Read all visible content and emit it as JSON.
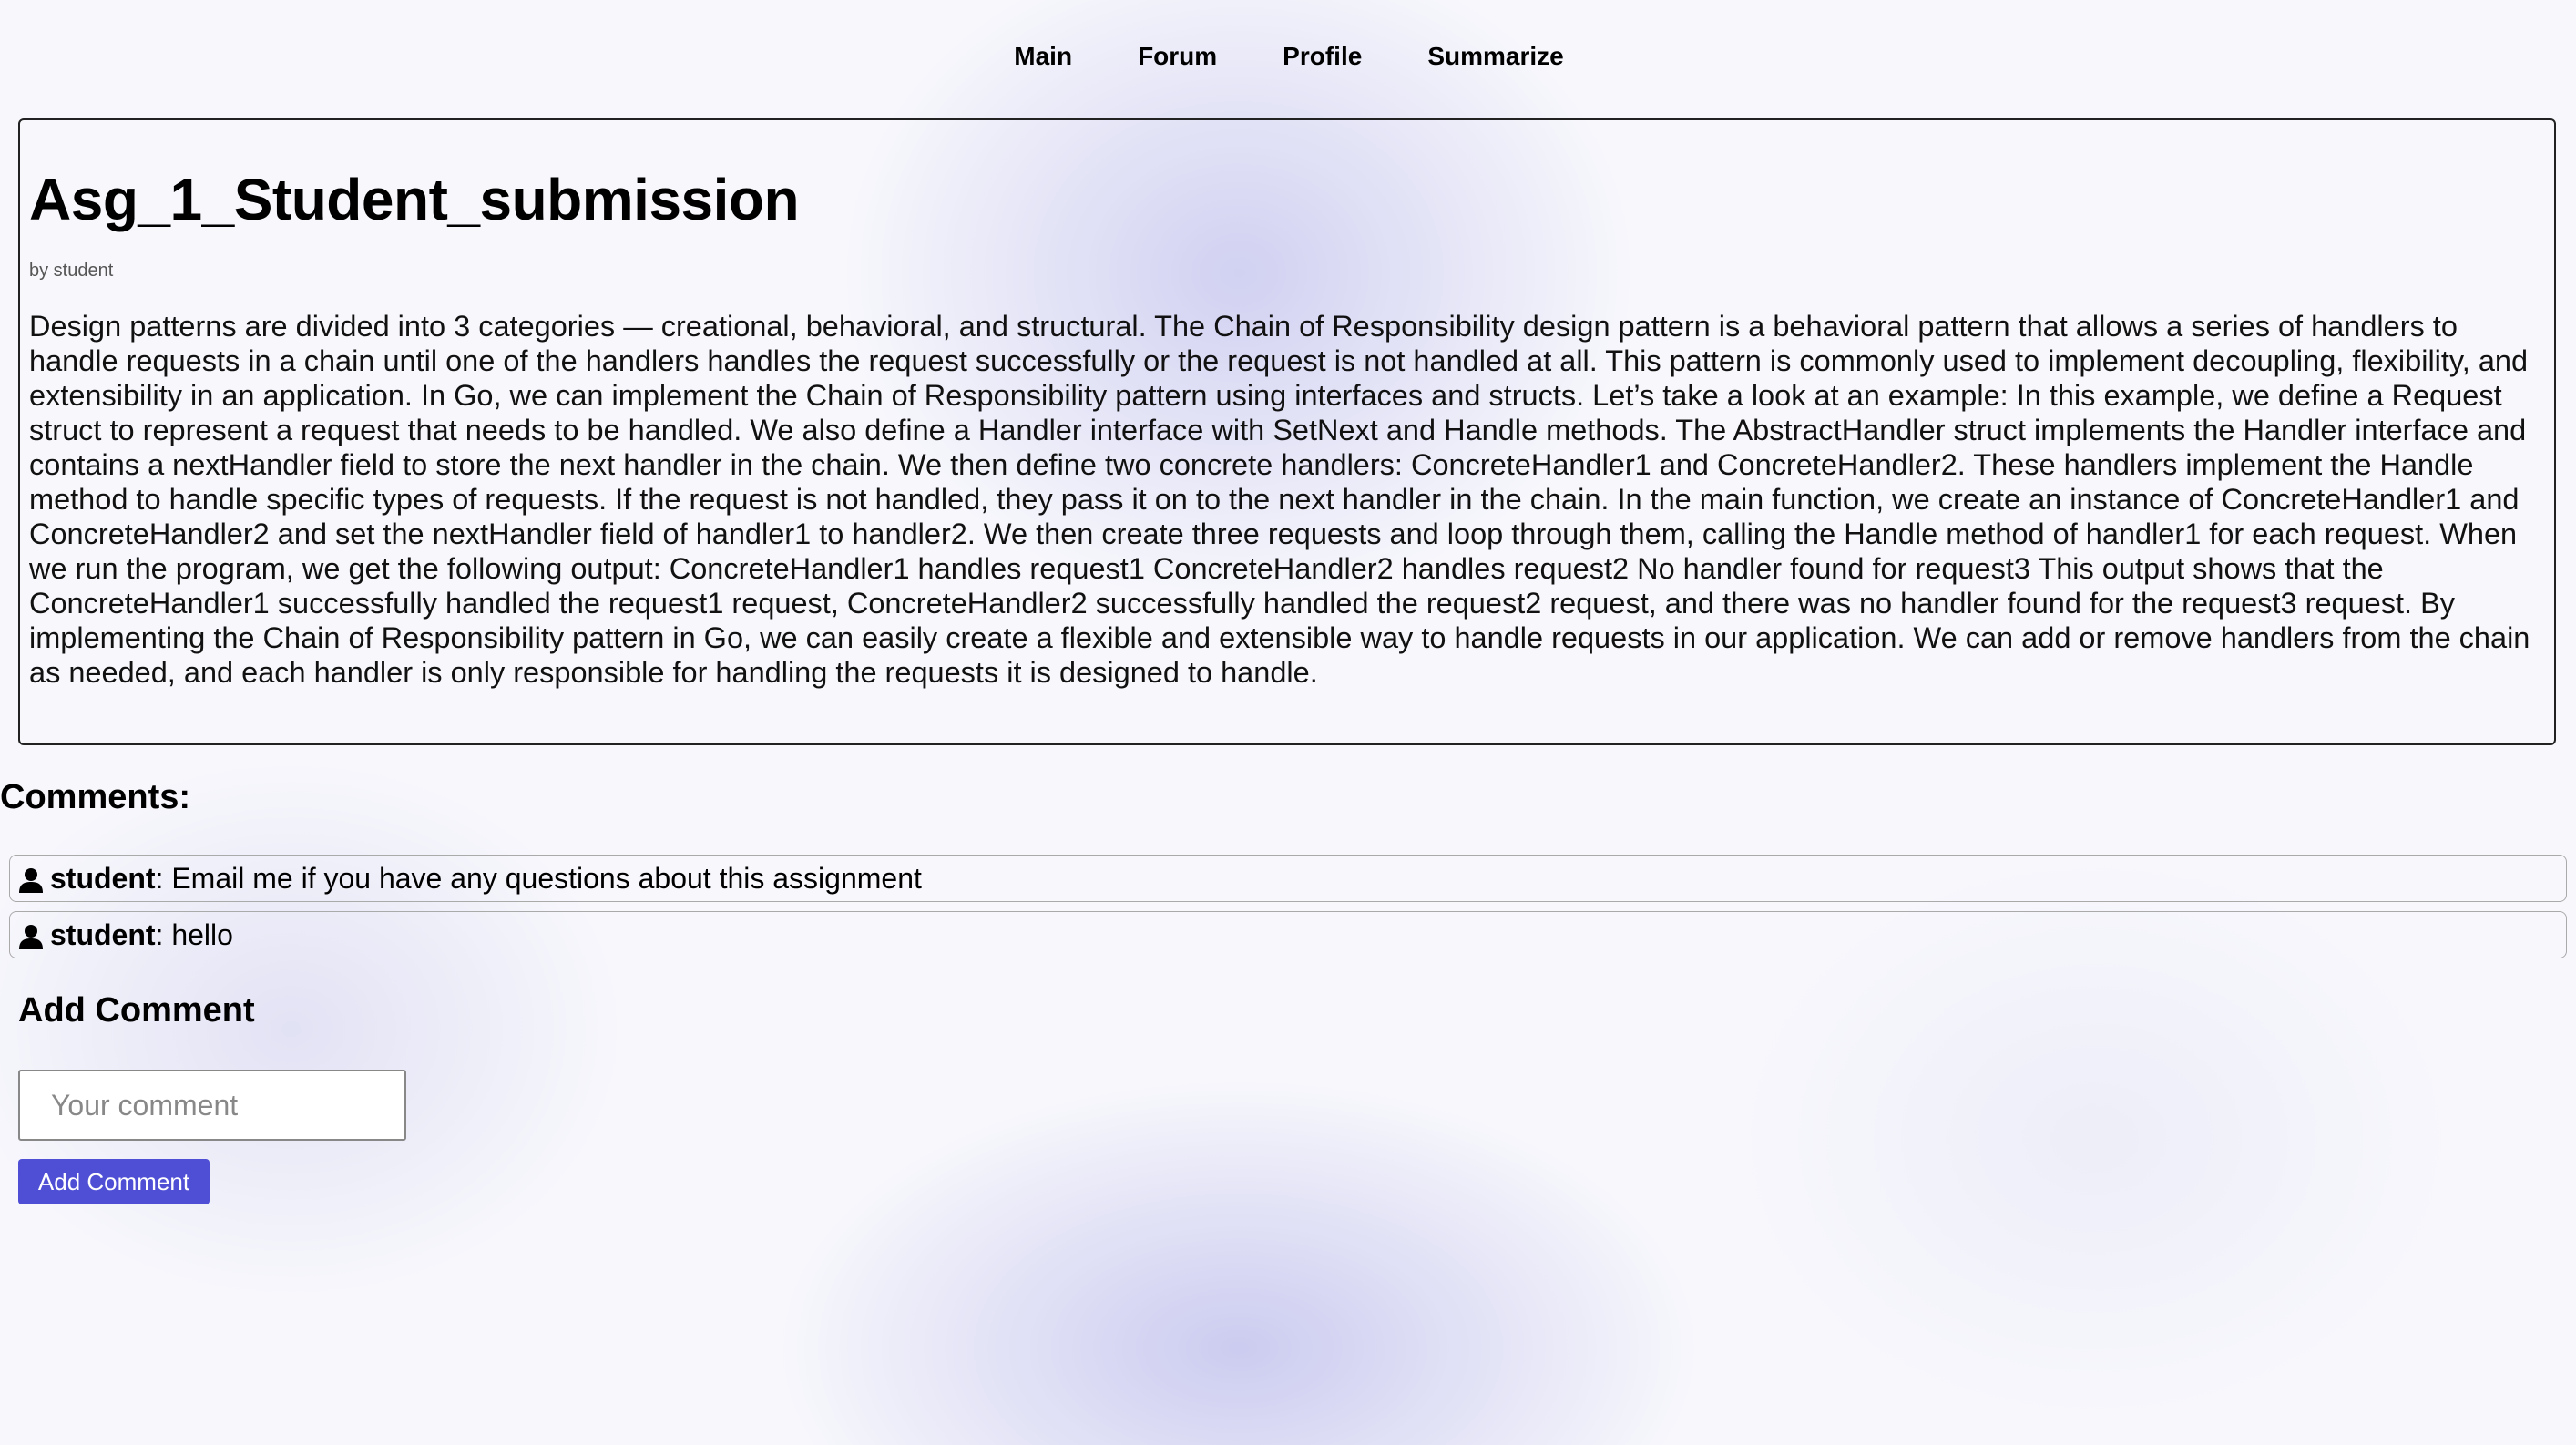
{
  "nav": {
    "items": [
      "Main",
      "Forum",
      "Profile",
      "Summarize"
    ]
  },
  "post": {
    "title": "Asg_1_Student_submission",
    "author_line": "by student",
    "body": "Design patterns are divided into 3 categories — creational, behavioral, and structural. The Chain of Responsibility design pattern is a behavioral pattern that allows a series of handlers to handle requests in a chain until one of the handlers handles the request successfully or the request is not handled at all. This pattern is commonly used to implement decoupling, flexibility, and extensibility in an application. In Go, we can implement the Chain of Responsibility pattern using interfaces and structs. Let’s take a look at an example: In this example, we define a Request struct to represent a request that needs to be handled. We also define a Handler interface with SetNext and Handle methods. The AbstractHandler struct implements the Handler interface and contains a nextHandler field to store the next handler in the chain. We then define two concrete handlers: ConcreteHandler1 and ConcreteHandler2. These handlers implement the Handle method to handle specific types of requests. If the request is not handled, they pass it on to the next handler in the chain. In the main function, we create an instance of ConcreteHandler1 and ConcreteHandler2 and set the nextHandler field of handler1 to handler2. We then create three requests and loop through them, calling the Handle method of handler1 for each request. When we run the program, we get the following output: ConcreteHandler1 handles request1 ConcreteHandler2 handles request2 No handler found for request3 This output shows that the ConcreteHandler1 successfully handled the request1 request, ConcreteHandler2 successfully handled the request2 request, and there was no handler found for the request3 request. By implementing the Chain of Responsibility pattern in Go, we can easily create a flexible and extensible way to handle requests in our application. We can add or remove handlers from the chain as needed, and each handler is only responsible for handling the requests it is designed to handle."
  },
  "comments": {
    "heading": "Comments:",
    "items": [
      {
        "icon": "user-icon",
        "author": "student",
        "separator": ": ",
        "text": "Email me if you have any questions about this assignment"
      },
      {
        "icon": "user-icon",
        "author": "student",
        "separator": ": ",
        "text": "hello"
      }
    ]
  },
  "add_comment": {
    "heading": "Add Comment",
    "placeholder": "Your comment",
    "value": "",
    "button_label": "Add Comment",
    "button_color": "#4f4fd6"
  }
}
